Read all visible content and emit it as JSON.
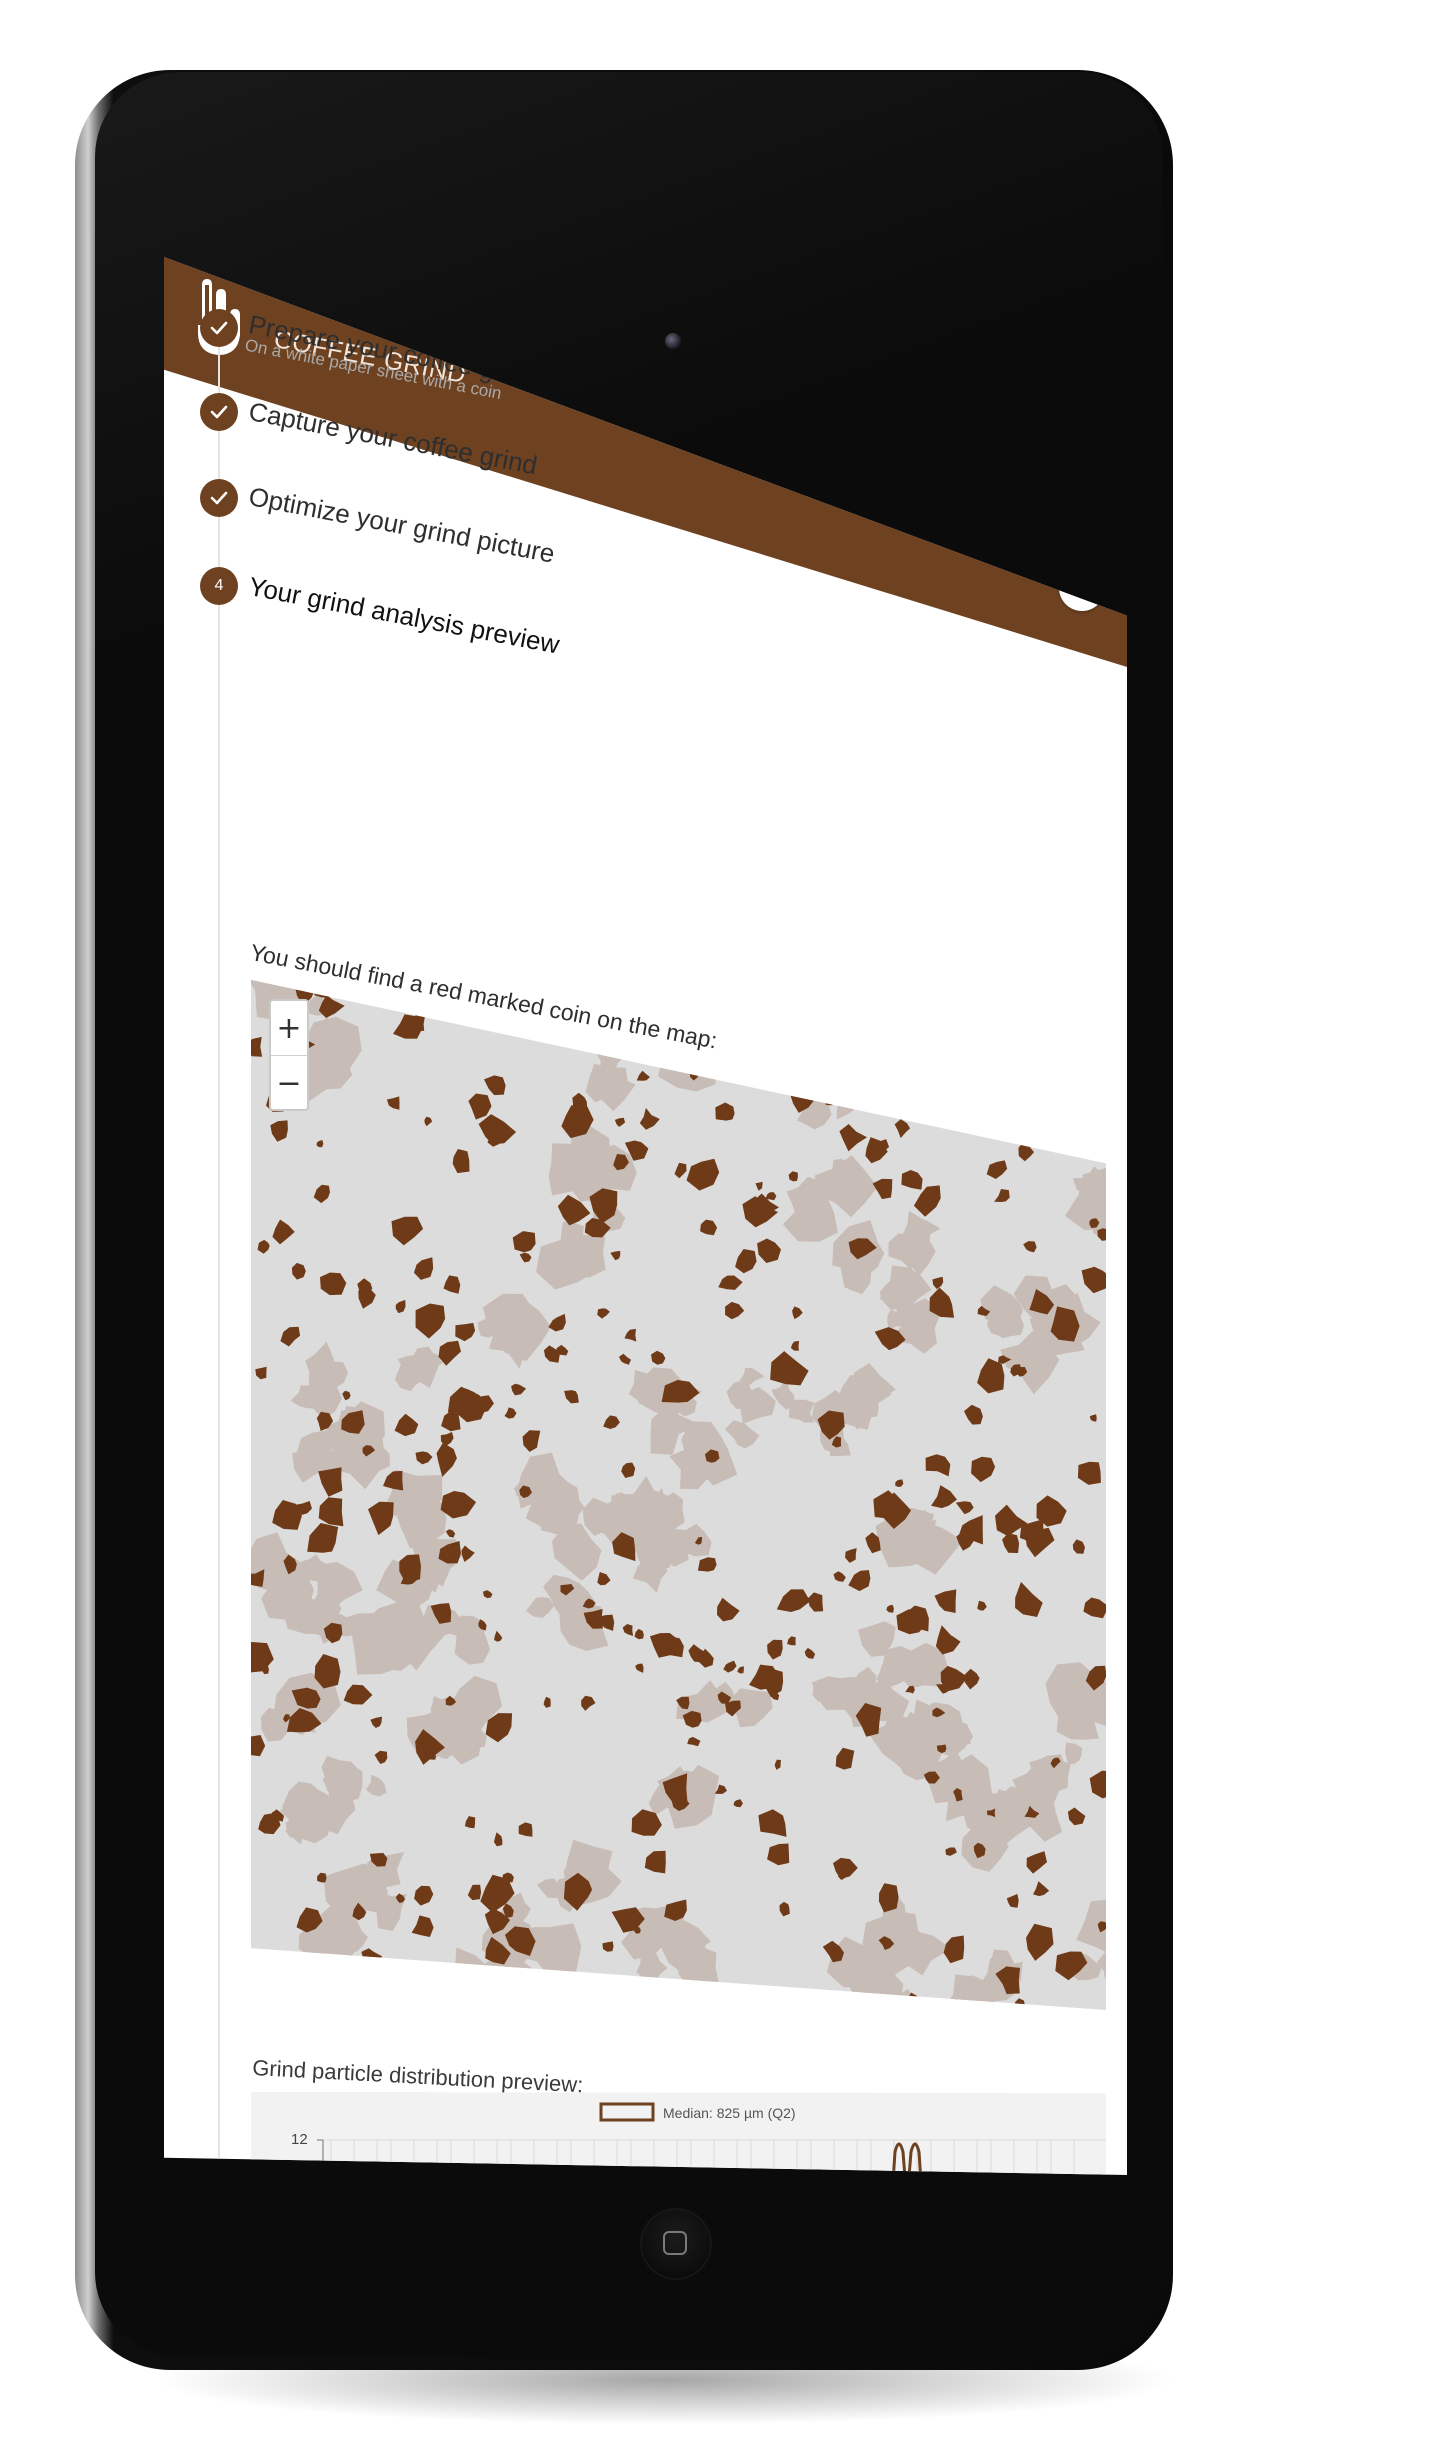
{
  "app": {
    "title": "COFFEE GRIND",
    "logo_icon": "hand-logo-icon",
    "home_icon": "home-icon"
  },
  "colors": {
    "brand": "#6e4221",
    "particle": "#6e3a17",
    "particle_faded": "#c8bcb6",
    "map_background": "#dcdcdc"
  },
  "steps": [
    {
      "state": "done",
      "marker": "",
      "title": "Prepare your coffee grind probe",
      "subtitle": "On a white paper sheet with a coin"
    },
    {
      "state": "done",
      "marker": "",
      "title": "Capture your coffee grind",
      "subtitle": ""
    },
    {
      "state": "done",
      "marker": "",
      "title": "Optimize your grind picture",
      "subtitle": ""
    },
    {
      "state": "active",
      "marker": "4",
      "title": "Your grind analysis preview",
      "subtitle": ""
    }
  ],
  "map": {
    "instruction": "You should find a red marked coin on the map:",
    "zoom_in": "+",
    "zoom_out": "−"
  },
  "distribution": {
    "label": "Grind particle distribution preview:",
    "legend": "Median: 825  µm (Q2)",
    "y_tick_top": "12"
  }
}
